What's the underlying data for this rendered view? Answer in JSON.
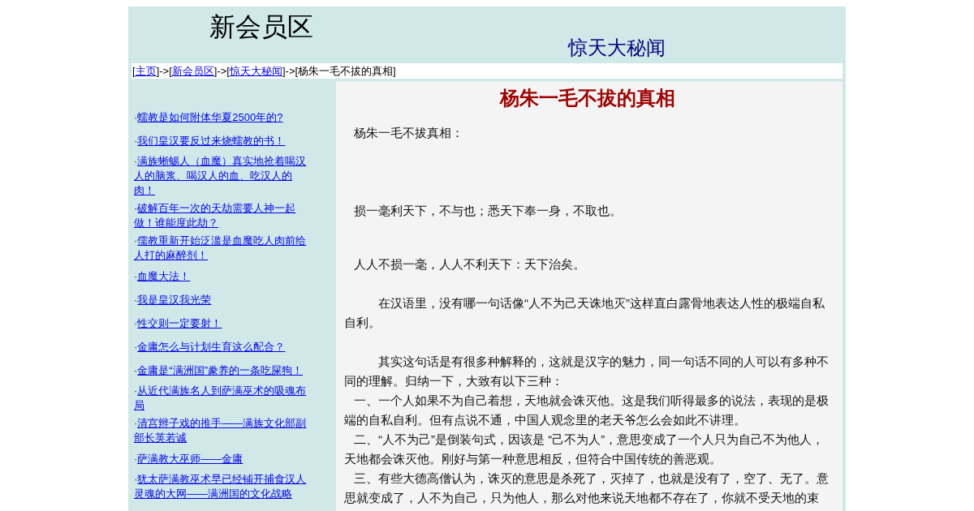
{
  "header": {
    "title": "新会员区",
    "subtitle": "惊天大秘闻"
  },
  "breadcrumb": [
    {
      "text": "[",
      "link": false
    },
    {
      "text": "主页",
      "link": true
    },
    {
      "text": "]->[",
      "link": false
    },
    {
      "text": "新会员区",
      "link": true
    },
    {
      "text": "]->[",
      "link": false
    },
    {
      "text": "惊天大秘闻",
      "link": true
    },
    {
      "text": "]->[杨朱一毛不拔的真相]",
      "link": false
    }
  ],
  "sidebar": {
    "items": [
      {
        "bullet": "·",
        "title": "蠕教是如何附体华夏2500年的?"
      },
      {
        "bullet": "·",
        "title": "我们皇汉要反过来烧蠕教的书！"
      },
      {
        "bullet": "·",
        "title": "满族蜥蜴人（血魔）真实地抢着喝汉人的脑浆、喝汉人的血、吃汉人的肉！"
      },
      {
        "bullet": "·",
        "title": "破解百年一次的天劫需要人神一起做！谁能度此劫？"
      },
      {
        "bullet": "·",
        "title": "儒教重新开始泛滥是血魔吃人肉前给人打的麻醉剂！"
      },
      {
        "bullet": "·",
        "title": "血魔大法！"
      },
      {
        "bullet": "·",
        "title": "我是皇汉我光荣"
      },
      {
        "bullet": "·",
        "title": "性交则一定要射！"
      },
      {
        "bullet": "·",
        "title": "金庸怎么与计划生育这么配合？"
      },
      {
        "bullet": "·",
        "title": "金庸是“满洲国”豢养的一条吃屎狗！"
      },
      {
        "bullet": "·",
        "title": "从近代满族名人到萨满巫术的吸魂布局"
      },
      {
        "bullet": "·",
        "title": "清宫辫子戏的推手——满族文化部副部长英若诚"
      },
      {
        "bullet": "·",
        "title": "萨满教大巫师——金庸"
      },
      {
        "bullet": "·",
        "title": "犹太萨满教巫术早已经铺开捕食汉人灵魂的大网——满洲国的文化战略"
      }
    ]
  },
  "article": {
    "title": "杨朱一毛不拔的真相",
    "paragraphs": [
      {
        "kind": "line",
        "text": "杨朱一毛不拔真相："
      },
      {
        "kind": "line",
        "text": "损一毫利天下，不与也；悉天下奉一身，不取也。"
      },
      {
        "kind": "line",
        "text": "人人不损一毫，人人不利天下：天下治矣。"
      },
      {
        "kind": "paragraph",
        "text": "在汉语里，没有哪一句话像“人不为己天诛地灭”这样直白露骨地表达人性的极端自私自利。"
      },
      {
        "kind": "paragraph",
        "text": "其实这句话是有很多种解释的，这就是汉字的魅力，同一句话不同的人可以有多种不同的理解。归纳一下，大致有以下三种："
      },
      {
        "kind": "line",
        "text": "一、一个人如果不为自己着想，天地就会诛灭他。这是我们听得最多的说法，表现的是极端的自私自利。但有点说不通，中国人观念里的老天爷怎么会如此不讲理。"
      },
      {
        "kind": "line",
        "text": "二、“人不为己”是倒装句式，因该是 “己不为人”，意思变成了一个人只为自己不为他人，天地都会诛灭他。刚好与第一种意思相反，但符合中国传统的善恶观。"
      },
      {
        "kind": "line",
        "text": "三、有些大德高僧认为，诛灭的意思是杀死了，灭掉了，也就是没有了，空了、无了。意思就变成了，人不为自己，只为他人，那么对他来说天地都不存在了，你就不受天地的束"
      }
    ]
  }
}
